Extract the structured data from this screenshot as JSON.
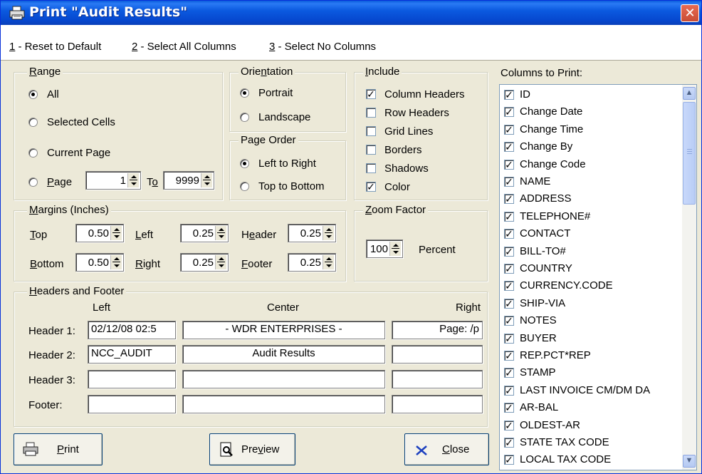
{
  "window": {
    "title": "Print \"Audit Results\"",
    "close_glyph": "✕"
  },
  "menu": [
    {
      "key": "1",
      "rest": " - Reset to Default"
    },
    {
      "key": "2",
      "rest": " - Select All Columns"
    },
    {
      "key": "3",
      "rest": " - Select No Columns"
    }
  ],
  "range": {
    "title_u": "R",
    "title_rest": "ange",
    "options": [
      "All",
      "Selected Cells",
      "Current Page"
    ],
    "page_u": "P",
    "page_rest": "age",
    "page_from": "1",
    "to_pre": "T",
    "to_u": "o",
    "page_to": "9999",
    "selected": "All"
  },
  "orientation": {
    "title_pre": "Orie",
    "title_u": "n",
    "title_rest": "tation",
    "options": [
      "Portrait",
      "Landscape"
    ],
    "selected": "Portrait"
  },
  "page_order": {
    "title": "Page Order",
    "options": [
      "Left to Right",
      "Top to Bottom"
    ],
    "selected": "Left to Right"
  },
  "include": {
    "title_u": "I",
    "title_rest": "nclude",
    "items": [
      {
        "label": "Column Headers",
        "checked": true
      },
      {
        "label": "Row Headers",
        "checked": false
      },
      {
        "label": "Grid Lines",
        "checked": false
      },
      {
        "label": "Borders",
        "checked": false
      },
      {
        "label": "Shadows",
        "checked": false
      },
      {
        "label": "Color",
        "checked": true
      }
    ]
  },
  "margins": {
    "title_u": "M",
    "title_rest": "argins (Inches)",
    "top_u": "T",
    "top_rest": "op",
    "top": "0.50",
    "left_u": "L",
    "left_rest": "eft",
    "left": "0.25",
    "header_pre": "H",
    "header_u": "e",
    "header_rest": "ader",
    "header": "0.25",
    "bottom_u": "B",
    "bottom_rest": "ottom",
    "bottom": "0.50",
    "right_u": "R",
    "right_rest": "ight",
    "right": "0.25",
    "footer_u": "F",
    "footer_rest": "ooter",
    "footer": "0.25"
  },
  "zoom": {
    "title_u": "Z",
    "title_rest": "oom Factor",
    "value": "100",
    "unit": "Percent"
  },
  "headers_footer": {
    "title_u": "H",
    "title_rest": "eaders and Footer",
    "col_left": "Left",
    "col_center": "Center",
    "col_right": "Right",
    "rows": [
      {
        "label": "Header 1:",
        "left": "02/12/08  02:5",
        "center": "-   WDR ENTERPRISES   -",
        "right": "Page: /p"
      },
      {
        "label": "Header 2:",
        "left": "NCC_AUDIT",
        "center": "Audit Results",
        "right": ""
      },
      {
        "label": "Header 3:",
        "left": "",
        "center": "",
        "right": ""
      },
      {
        "label": "Footer:",
        "left": "",
        "center": "",
        "right": ""
      }
    ]
  },
  "buttons": {
    "print_u": "P",
    "print_rest": "rint",
    "preview_pre": "Pre",
    "preview_u": "v",
    "preview_rest": "iew",
    "close_u": "C",
    "close_rest": "lose"
  },
  "columns": {
    "title": "Columns to Print:",
    "items": [
      "ID",
      "Change Date",
      "Change Time",
      "Change By",
      "Change Code",
      "NAME",
      "ADDRESS",
      "TELEPHONE#",
      "CONTACT",
      "BILL-TO#",
      "COUNTRY",
      "CURRENCY.CODE",
      "SHIP-VIA",
      "NOTES",
      "BUYER",
      "REP.PCT*REP",
      "STAMP",
      "LAST INVOICE CM/DM DA",
      "AR-BAL",
      "OLDEST-AR",
      "STATE TAX CODE",
      "LOCAL TAX CODE"
    ],
    "all_checked": true
  },
  "colors": {
    "titlebar": "#0a5ddc",
    "face": "#ece9d8",
    "close": "#d9583e"
  }
}
